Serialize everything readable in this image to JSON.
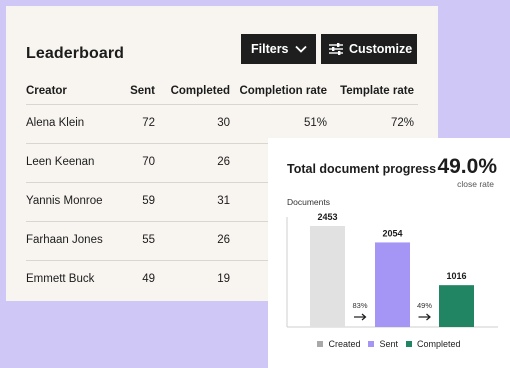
{
  "leaderboard": {
    "title": "Leaderboard",
    "filters_label": "Filters",
    "customize_label": "Customize",
    "columns": {
      "creator": "Creator",
      "sent": "Sent",
      "completed": "Completed",
      "completion_rate": "Completion rate",
      "template_rate": "Template rate"
    },
    "rows": [
      {
        "creator": "Alena Klein",
        "sent": "72",
        "completed": "30",
        "completion_rate": "51%",
        "template_rate": "72%"
      },
      {
        "creator": "Leen Keenan",
        "sent": "70",
        "completed": "26",
        "completion_rate": "",
        "template_rate": ""
      },
      {
        "creator": "Yannis Monroe",
        "sent": "59",
        "completed": "31",
        "completion_rate": "",
        "template_rate": ""
      },
      {
        "creator": "Farhaan Jones",
        "sent": "55",
        "completed": "26",
        "completion_rate": "",
        "template_rate": ""
      },
      {
        "creator": "Emmett Buck",
        "sent": "49",
        "completed": "19",
        "completion_rate": "",
        "template_rate": ""
      }
    ]
  },
  "progress": {
    "title": "Total document progress",
    "rate_value": "49.0%",
    "rate_label": "close rate",
    "axis_label": "Documents"
  },
  "chart_data": {
    "type": "bar",
    "title": "Total document progress",
    "ylabel": "Documents",
    "categories": [
      "Created",
      "Sent",
      "Completed"
    ],
    "values": [
      2453,
      2054,
      1016
    ],
    "colors": [
      "#e1e1e1",
      "#a596f5",
      "#218462"
    ],
    "conversions": [
      "83%",
      "49%"
    ],
    "legend": [
      "Created",
      "Sent",
      "Completed"
    ],
    "legend_position": "bottom"
  },
  "icons": {
    "filters": "chevron-down-icon",
    "customize": "sliders-icon",
    "conversion": "arrow-right-icon"
  },
  "colors": {
    "background": "#cfc8f6",
    "button_dark": "#1e1e1e",
    "created": "#e1e1e1",
    "sent": "#a596f5",
    "completed": "#218462"
  }
}
